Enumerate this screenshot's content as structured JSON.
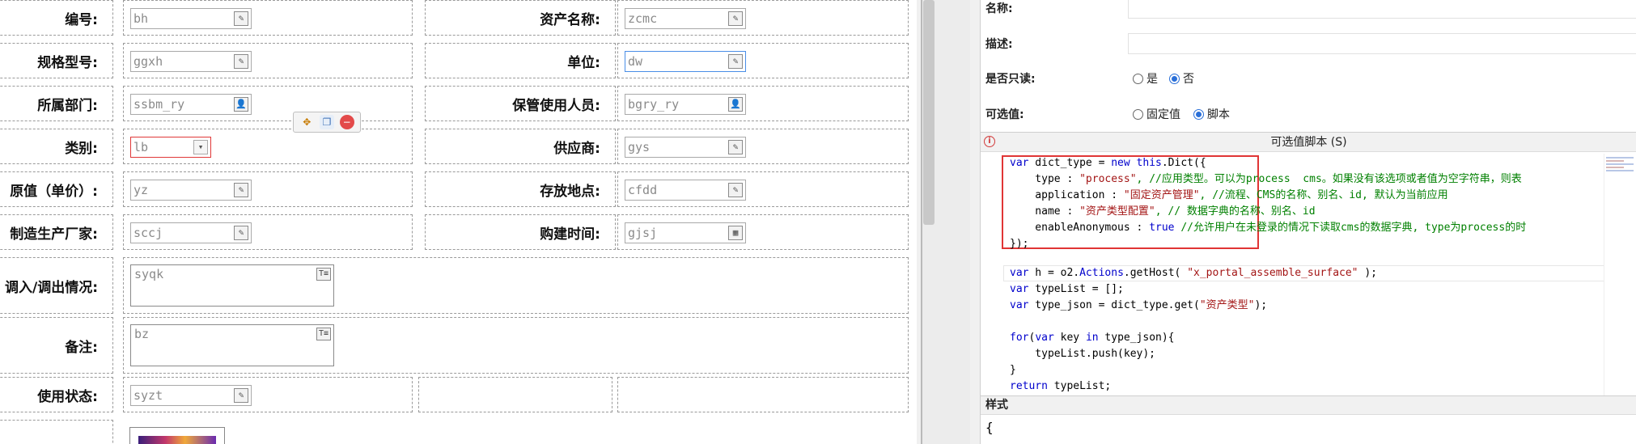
{
  "designer": {
    "rows": [
      {
        "left_label": "编号:",
        "left_value": "bh",
        "left_icon": "edit-icon",
        "right_label": "资产名称:",
        "right_value": "zcmc",
        "right_icon": "edit-icon"
      },
      {
        "left_label": "规格型号:",
        "left_value": "ggxh",
        "left_icon": "edit-icon",
        "right_label": "单位:",
        "right_value": "dw",
        "right_icon": "edit-icon"
      },
      {
        "left_label": "所属部门:",
        "left_value": "ssbm_ry",
        "left_icon": "person-icon",
        "right_label": "保管使用人员:",
        "right_value": "bgry_ry",
        "right_icon": "person-icon"
      },
      {
        "left_label": "类别:",
        "left_value": "lb",
        "left_icon": "dropdown-icon",
        "right_label": "供应商:",
        "right_value": "gys",
        "right_icon": "edit-icon"
      },
      {
        "left_label": "原值（单价）:",
        "left_value": "yz",
        "left_icon": "edit-icon",
        "right_label": "存放地点:",
        "right_value": "cfdd",
        "right_icon": "edit-icon"
      },
      {
        "left_label": "制造生产厂家:",
        "left_value": "sccj",
        "left_icon": "edit-icon",
        "right_label": "购建时间:",
        "right_value": "gjsj",
        "right_icon": "calendar-icon"
      }
    ],
    "textareas": [
      {
        "label": "调入/调出情况:",
        "value": "syqk"
      },
      {
        "label": "备注:",
        "value": "bz"
      }
    ],
    "status_row": {
      "label": "使用状态:",
      "value": "syzt"
    }
  },
  "props": {
    "name_label": "名称:",
    "desc_label": "描述:",
    "readonly_label": "是否只读:",
    "readonly_yes": "是",
    "readonly_no": "否",
    "options_label": "可选值:",
    "options_fixed": "固定值",
    "options_script": "脚本",
    "script_title": "可选值脚本 (S)",
    "style_title": "样式",
    "style_brace": "{"
  },
  "code": {
    "l1": "var dict_type = new this.Dict({",
    "l2a": "    type : ",
    "l2b": "\"process\"",
    "l2c": ", //应用类型。可以为process  cms。如果没有该选项或者值为空字符串，则表",
    "l3a": "    application : ",
    "l3b": "\"固定资产管理\"",
    "l3c": ", //流程、CMS的名称、别名、id, 默认为当前应用",
    "l4a": "    name : ",
    "l4b": "\"资产类型配置\"",
    "l4c": ", // 数据字典的名称、别名、id",
    "l5a": "    enableAnonymous : ",
    "l5b": "true",
    "l5c": " //允许用户在未登录的情况下读取cms的数据字典, type为process的时",
    "l6": "});",
    "l8a": "var h = o2.",
    "l8b": "Actions",
    "l8c": ".getHost( ",
    "l8d": "\"x_portal_assemble_surface\"",
    "l8e": " );",
    "l9": "var typeList = [];",
    "l10a": "var type_json = dict_type.get(",
    "l10b": "\"资产类型\"",
    "l10c": ");",
    "l12": "for(var key in type_json){",
    "l13": "    typeList.push(key);",
    "l14": "}",
    "l15": "return typeList;"
  }
}
